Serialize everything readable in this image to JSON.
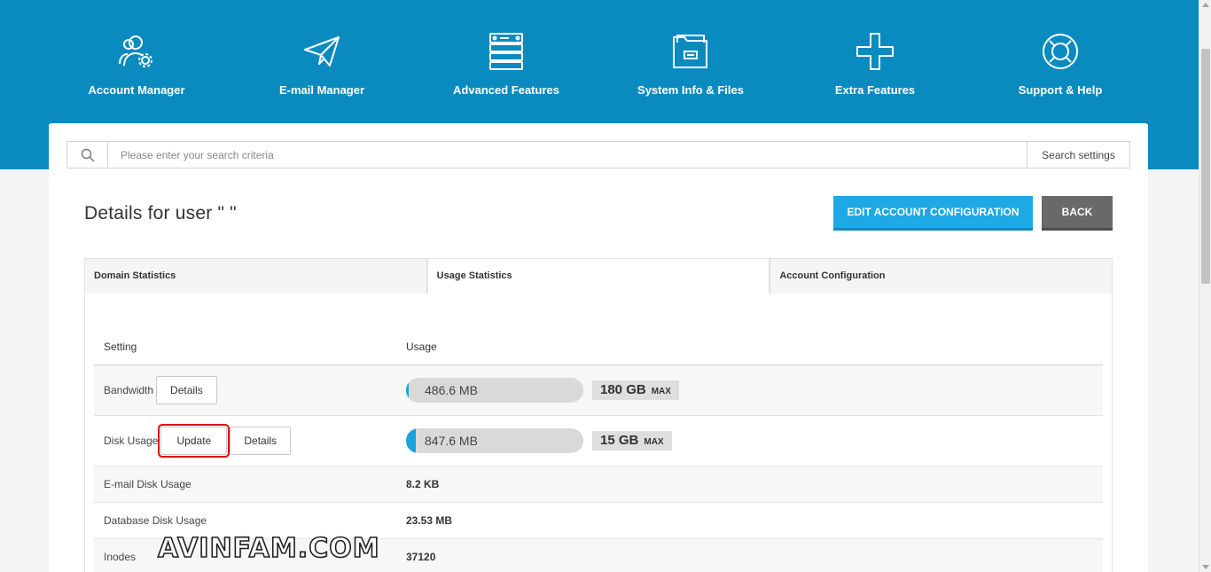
{
  "colors": {
    "header": "#0a8bbf",
    "accent": "#1ca9e6",
    "back": "#696969",
    "highlight": "#e00000"
  },
  "nav": [
    {
      "label": "Account Manager",
      "icon": "account-manager-icon"
    },
    {
      "label": "E-mail Manager",
      "icon": "paper-plane-icon"
    },
    {
      "label": "Advanced Features",
      "icon": "server-database-icon"
    },
    {
      "label": "System Info & Files",
      "icon": "file-folder-icon"
    },
    {
      "label": "Extra Features",
      "icon": "plus-icon"
    },
    {
      "label": "Support & Help",
      "icon": "lifebuoy-icon"
    }
  ],
  "search": {
    "placeholder": "Please enter your search criteria",
    "settings_label": "Search settings"
  },
  "page": {
    "title": "Details for user \"             \"",
    "edit_label": "EDIT ACCOUNT CONFIGURATION",
    "back_label": "BACK"
  },
  "tabs": [
    {
      "label": "Domain Statistics",
      "active": false
    },
    {
      "label": "Usage Statistics",
      "active": true
    },
    {
      "label": "Account Configuration",
      "active": false
    }
  ],
  "table": {
    "headers": [
      "Setting",
      "Usage"
    ],
    "bandwidth": {
      "label": "Bandwidth",
      "details_label": "Details",
      "used": "486.6 MB",
      "used_fraction": 0.003,
      "max": "180 GB",
      "max_unit": "MAX"
    },
    "disk": {
      "label": "Disk Usage",
      "update_label": "Update",
      "details_label": "Details",
      "used": "847.6 MB",
      "used_fraction": 0.055,
      "max": "15 GB",
      "max_unit": "MAX"
    },
    "email_disk": {
      "label": "E-mail Disk Usage",
      "value": "8.2 KB"
    },
    "db_disk": {
      "label": "Database Disk Usage",
      "value": "23.53 MB"
    },
    "inodes": {
      "label": "Inodes",
      "value": "37120"
    }
  },
  "watermark": "AVINFAM.COM"
}
